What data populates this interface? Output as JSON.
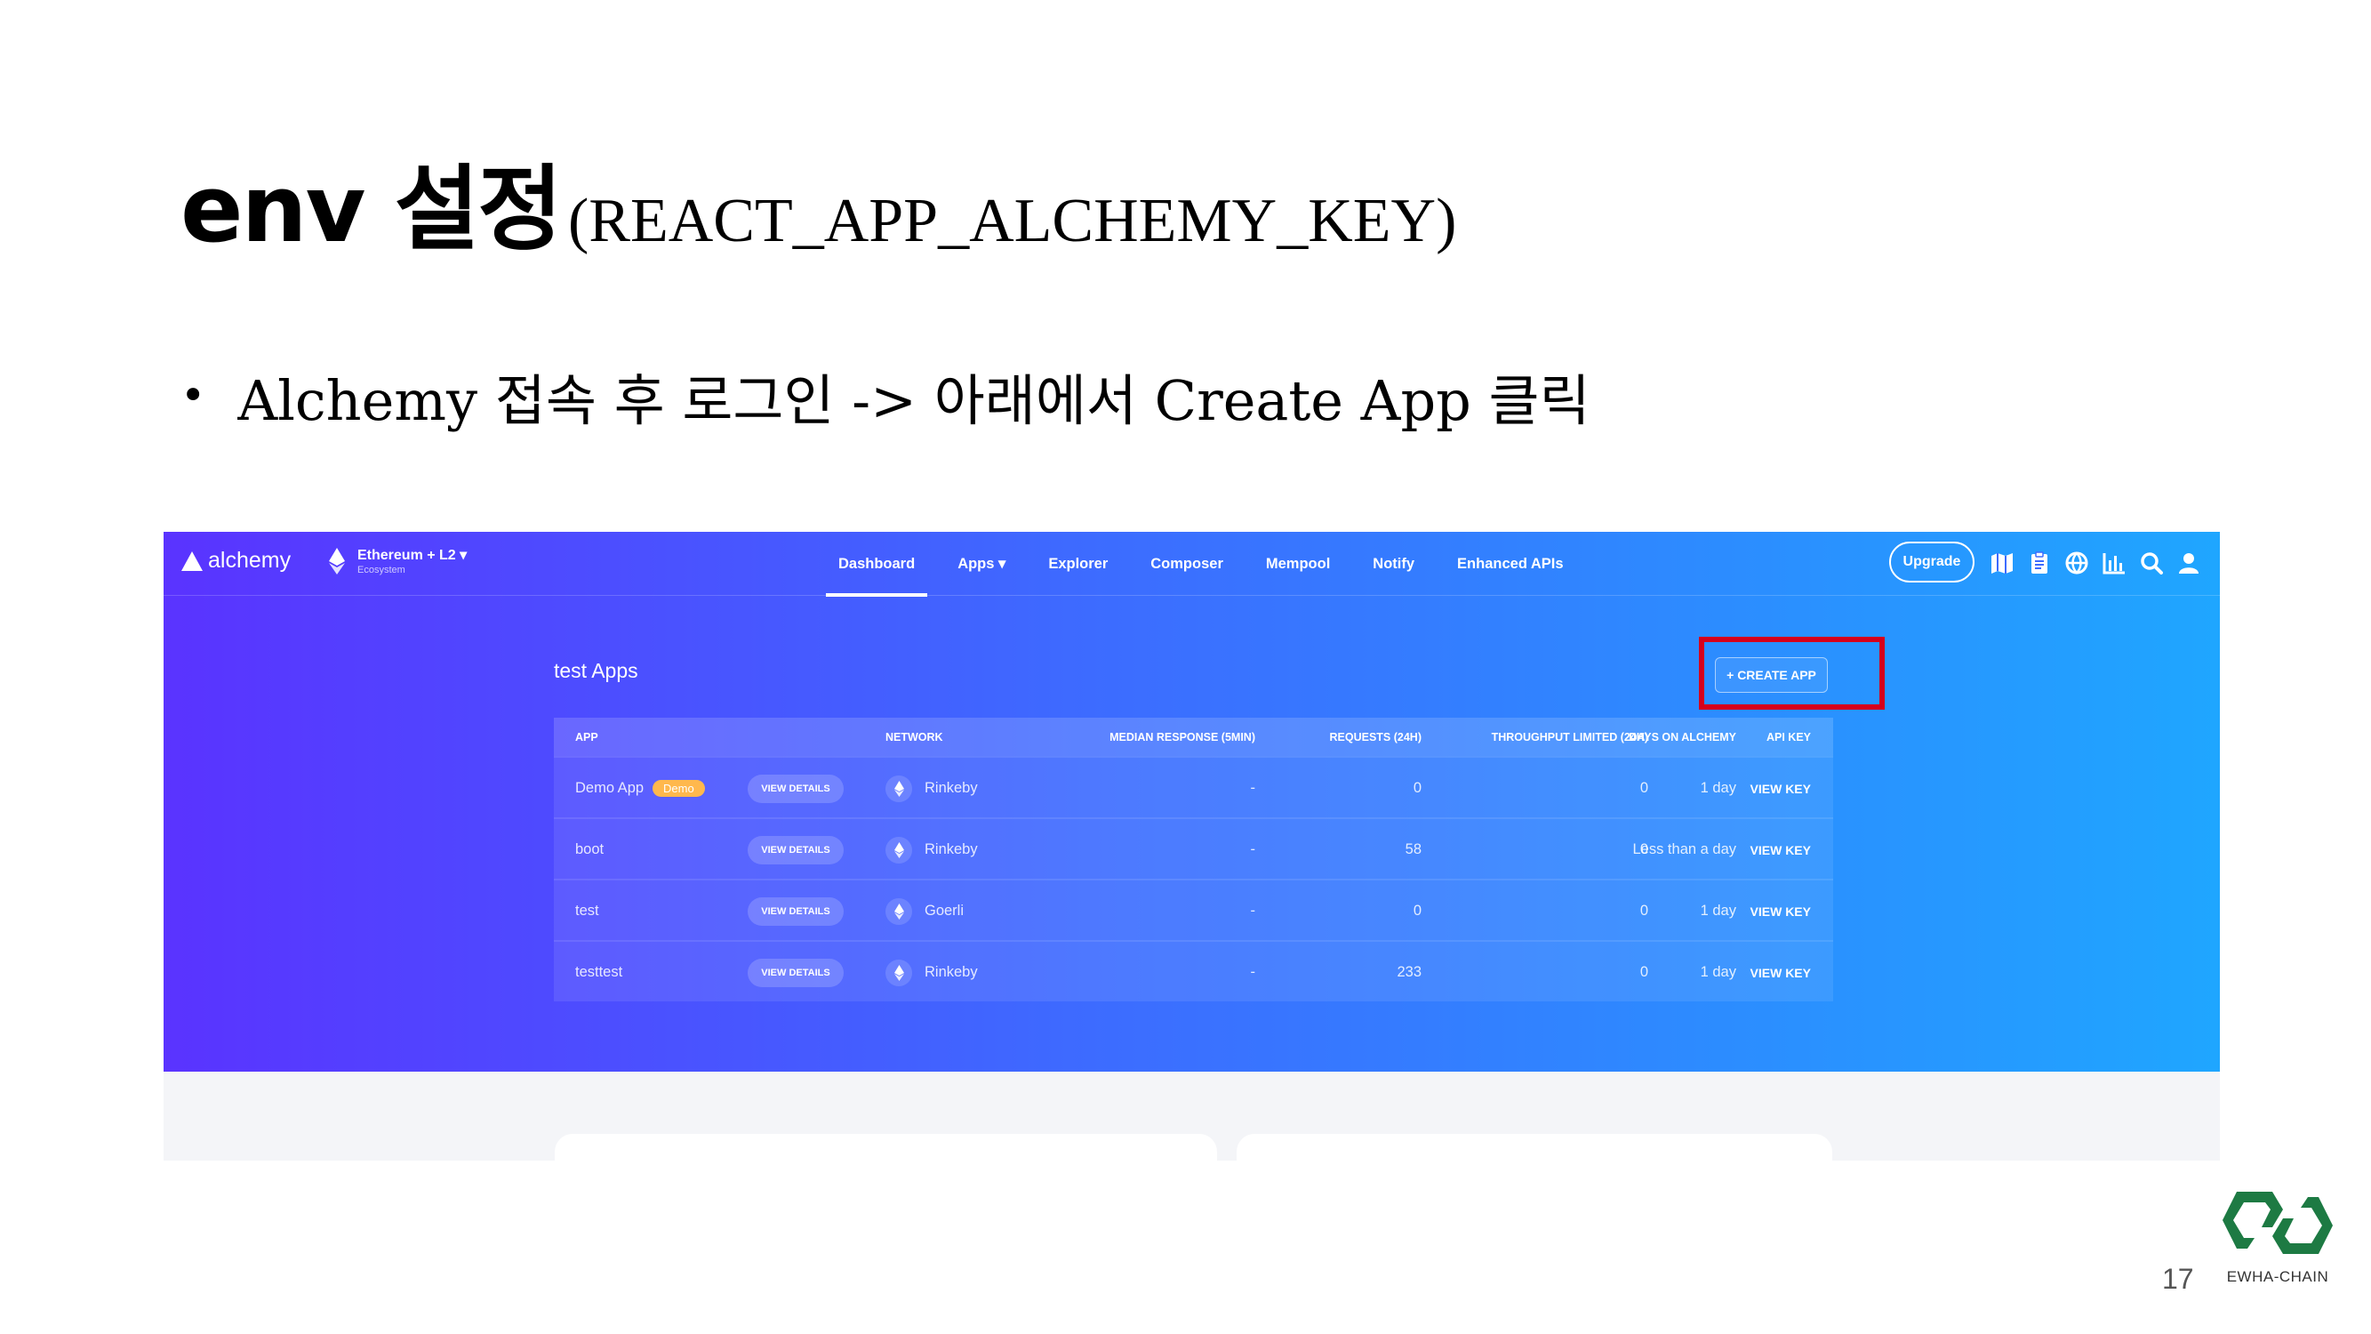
{
  "slide": {
    "title_main": "env 설정",
    "title_sub": "(REACT_APP_ALCHEMY_KEY)",
    "bullet": "Alchemy 접속 후 로그인 -> 아래에서 Create App 클릭",
    "page_number": "17",
    "brand_name": "EWHA-CHAIN"
  },
  "nav": {
    "logo": "alchemy",
    "network_name": "Ethereum + L2",
    "network_sub": "Ecosystem",
    "links": [
      "Dashboard",
      "Apps",
      "Explorer",
      "Composer",
      "Mempool",
      "Notify",
      "Enhanced APIs"
    ],
    "active_link": "Dashboard",
    "upgrade": "Upgrade",
    "icons": [
      "map-icon",
      "clipboard-icon",
      "globe-icon",
      "stats-icon",
      "search-icon",
      "user-icon"
    ]
  },
  "apps": {
    "title": "test Apps",
    "create_button": "+ CREATE APP",
    "headers": {
      "app": "APP",
      "network": "NETWORK",
      "median": "MEDIAN RESPONSE (5MIN)",
      "requests": "REQUESTS (24H)",
      "throughput": "THROUGHPUT LIMITED (24H)",
      "days": "DAYS ON ALCHEMY",
      "key": "API KEY"
    },
    "details_label": "VIEW DETAILS",
    "rows": [
      {
        "app": "Demo App",
        "badge": "Demo",
        "network": "Rinkeby",
        "median": "-",
        "requests": "0",
        "throughput": "0",
        "days": "1 day",
        "key": "VIEW KEY"
      },
      {
        "app": "boot",
        "badge": "",
        "network": "Rinkeby",
        "median": "-",
        "requests": "58",
        "throughput": "0",
        "days": "Less than a day",
        "key": "VIEW KEY"
      },
      {
        "app": "test",
        "badge": "",
        "network": "Goerli",
        "median": "-",
        "requests": "0",
        "throughput": "0",
        "days": "1 day",
        "key": "VIEW KEY"
      },
      {
        "app": "testtest",
        "badge": "",
        "network": "Rinkeby",
        "median": "-",
        "requests": "233",
        "throughput": "0",
        "days": "1 day",
        "key": "VIEW KEY"
      }
    ]
  },
  "colors": {
    "gradient_start": "#5a33ff",
    "gradient_end": "#1fa6ff",
    "highlight": "#d6001c",
    "demo_badge": "#ffb84d",
    "brand_green": "#1d7a43"
  }
}
